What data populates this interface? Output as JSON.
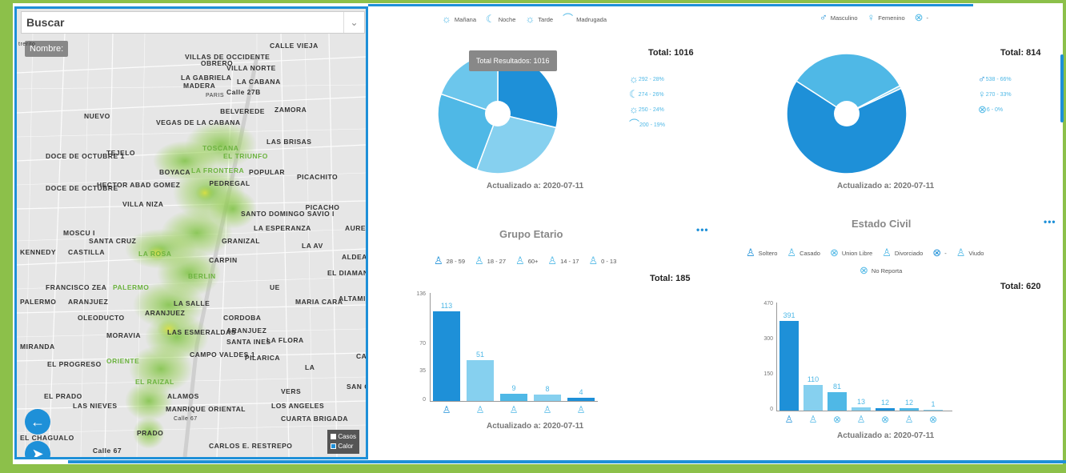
{
  "search": {
    "label": "Buscar",
    "caret": "⌄"
  },
  "map": {
    "nombre_button": "Nombre:",
    "labels": [
      "trerito",
      "CALLE VIEJA",
      "VILLAS DE OCCIDENTE",
      "OBRERO",
      "VILLA NORTE",
      "LA GABRIELA",
      "LA CABANA",
      "MADERA",
      "Calle 27B",
      "PARIS",
      "NUEVO",
      "VEGAS DE LA CABANA",
      "BELVEREDE",
      "ZAMORA",
      "LAS BRISAS",
      "TOSCANA",
      "EL TRIUNFO",
      "DOCE DE OCTUBRE 1",
      "TEJELO",
      "BOYACA",
      "LA FRONTERA",
      "POPULAR",
      "PICACHITO",
      "DOCE DE OCTUBRE",
      "HECTOR ABAD GOMEZ",
      "PEDREGAL",
      "VILLA NIZA",
      "SANTO DOMINGO SAVIO I",
      "PICACHO",
      "MOSCU I",
      "LA ESPERANZA",
      "SANTA CRUZ",
      "GRANIZAL",
      "LA AV",
      "AURES II",
      "KENNEDY",
      "CASTILLA",
      "LA ROSA",
      "CARPIN",
      "ALDEA PABLO VI",
      "EL DIAMANTE",
      "FRANCISCO ZEA",
      "PALERMO",
      "BERLIN",
      "UE",
      "PALERMO",
      "ARANJUEZ",
      "LA SALLE",
      "MARIA CARA",
      "ALTAMIRA",
      "OLEODUCTO",
      "ARANJUEZ",
      "CORDOBA",
      "MORAVIA",
      "LAS ESMERALDAS",
      "ARANJUEZ",
      "SANTA INES",
      "LA FLORA",
      "MIRANDA",
      "CAMPO VALDES 1",
      "PILARICA",
      "EL PROGRESO",
      "ORIENTE",
      "LA",
      "CARIBE",
      "EL RAIZAL",
      "VERS",
      "SAN GERMAN",
      "EL PRADO",
      "ALAMOS",
      "LAS NIEVES",
      "LOS ANGELES",
      "MANRIQUE ORIENTAL",
      "CUARTA BRIGADA",
      "EL CHAGUALO",
      "PRADO",
      "CARLOS E. RESTREPO",
      "Calle 67",
      "Calle 67"
    ],
    "layers": {
      "casos": "Casos",
      "calor": "Calor"
    }
  },
  "colors": {
    "accent": "#1e90d8",
    "light": "#4fb8e6",
    "lighter": "#86d0ef",
    "frame": "#8cc04a"
  },
  "jornada": {
    "legend": [
      {
        "icon": "sun-icon",
        "glyph": "☼",
        "label": "Mañana"
      },
      {
        "icon": "moon-icon",
        "glyph": "☾",
        "label": "Noche"
      },
      {
        "icon": "sunset-icon",
        "glyph": "☼",
        "label": "Tarde"
      },
      {
        "icon": "dawn-icon",
        "glyph": "⌒",
        "label": "Madrugada"
      }
    ],
    "total": "Total: 1016",
    "tooltip": "Total Resultados: 1016",
    "updated": "Actualizado a: 2020-07-11",
    "slice_legend": [
      "292 - 28%",
      "274 - 26%",
      "250 - 24%",
      "200 - 19%"
    ]
  },
  "genero": {
    "legend": [
      {
        "icon": "male-icon",
        "glyph": "♂",
        "label": "Masculino"
      },
      {
        "icon": "female-icon",
        "glyph": "♀",
        "label": "Femenino"
      },
      {
        "icon": "unknown-icon",
        "glyph": "⊗",
        "label": "-"
      }
    ],
    "total": "Total: 814",
    "updated": "Actualizado a: 2020-07-11",
    "slice_legend": [
      "538 - 66%",
      "270 - 33%",
      "6 - 0%"
    ]
  },
  "etario": {
    "title": "Grupo Etario",
    "menu": "•••",
    "legend": [
      "28 - 59",
      "18 - 27",
      "60+",
      "14 - 17",
      "0 - 13"
    ],
    "total": "Total: 185",
    "updated": "Actualizado a: 2020-07-11",
    "yticks": [
      "136",
      "70",
      "35",
      "0"
    ]
  },
  "civil": {
    "title": "Estado Civil",
    "menu": "•••",
    "legend": [
      "Soltero",
      "Casado",
      "Union Libre",
      "Divorciado",
      "-",
      "Viudo",
      "No Reporta"
    ],
    "total": "Total: 620",
    "updated": "Actualizado a: 2020-07-11",
    "yticks": [
      "470",
      "300",
      "150",
      "0"
    ]
  },
  "chart_data": [
    {
      "type": "pie",
      "title": "",
      "total": 1016,
      "labels": [
        "Mañana",
        "Noche",
        "Tarde",
        "Madrugada"
      ],
      "values": [
        292,
        274,
        250,
        200
      ],
      "percent": [
        28,
        26,
        24,
        19
      ]
    },
    {
      "type": "pie",
      "title": "",
      "total": 814,
      "labels": [
        "Masculino",
        "Femenino",
        "-"
      ],
      "values": [
        538,
        270,
        6
      ],
      "percent": [
        66,
        33,
        0
      ]
    },
    {
      "type": "bar",
      "title": "Grupo Etario",
      "categories": [
        "28 - 59",
        "18 - 27",
        "60+",
        "14 - 17",
        "0 - 13"
      ],
      "values": [
        113,
        51,
        9,
        8,
        4
      ],
      "ylim": [
        0,
        136
      ],
      "total": 185
    },
    {
      "type": "bar",
      "title": "Estado Civil",
      "categories": [
        "Soltero",
        "Casado",
        "Union Libre",
        "Divorciado",
        "-",
        "Viudo",
        "No Reporta"
      ],
      "values": [
        391,
        110,
        81,
        13,
        12,
        12,
        1
      ],
      "ylim": [
        0,
        470
      ],
      "total": 620
    }
  ]
}
